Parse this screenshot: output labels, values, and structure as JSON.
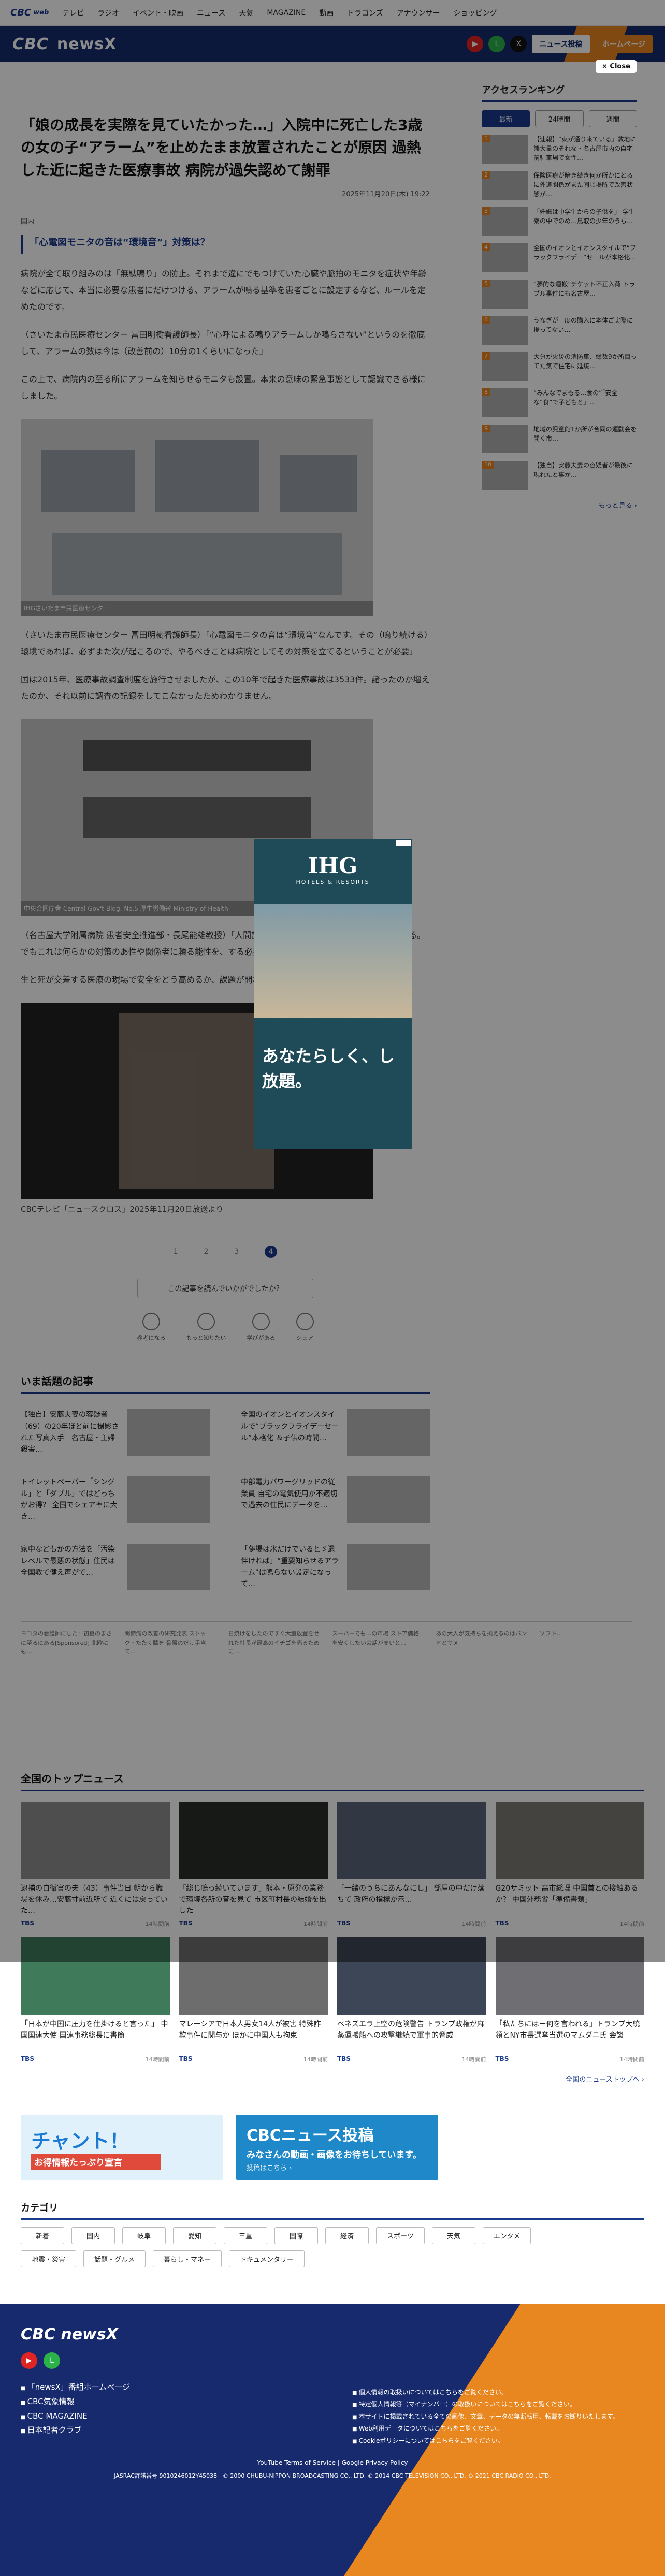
{
  "topnav": {
    "logo": "CBC",
    "logo_sub": "web",
    "items": [
      "テレビ",
      "ラジオ",
      "イベント・映画",
      "ニュース",
      "天気",
      "MAGAZINE",
      "動画",
      "ドラゴンズ",
      "アナウンサー",
      "ショッピング"
    ]
  },
  "header": {
    "brand": "CBC",
    "brand_name": "newsX",
    "btn_news": "ニュース投稿",
    "btn_home": "ホームページ"
  },
  "close_label": "× Close",
  "article": {
    "title": "「娘の成長を実際を見ていたかった…」入院中に死亡した3歳の女の子“アラーム”を止めたまま放置されたことが原因 過熱した近に起きた医療事故 病院が過失認めて謝罪",
    "date": "2025年11月20日(木) 19:22",
    "category": "国内",
    "subhead": "「心電図モニタの音は“環境音”」対策は？",
    "paras": [
      "病院が全て取り組みのは「無駄鳴り」の防止。それまで違にでもつけていた心臓や脈拍のモニタを症状や年齢などに応じて、本当に必要な患者にだけつける、アラームが鳴る基準を患者ごとに設定するなど、ルールを定めたのです。",
      "（さいたま市民医療センター 冨田明樹看護師長）「“心呼による鳴りアラームしか鳴らさない”というのを徹底して、アラームの数は今は（改善前の）10分の1くらいになった」",
      "この上で、病院内の至る所にアラームを知らせるモニタも設置。本来の意味の緊急事態として認識できる様にしました。",
      "（さいたま市民医療センター 冨田明樹看護師長）「心電図モニタの音は“環境音”なんです。その（鳴り続ける）環境であれば、必ずまた次が起こるので、やるべきことは病院としてその対策を立てるということが必要」",
      "国は2015年、医療事故調査制度を施行させましたが、この10年で起きた医療事故は3533件。諸ったのか増えたのか、それ以前に調査の記録をしてこなかったためわかりません。",
      "（名古屋大学附属病院 患者安全推進部・長尾能雄教授）「人間誰もがミスをする。医療者も必ずミスをする。でもこれは何らかの対策のあ性や関係者に頼る能性を、する必要がある。",
      "生と死が交差する医療の現場で安全をどう高めるか、課題が問われています。"
    ],
    "img1_label": "IHGさいたま市民医療センター",
    "img2_label": "中央合同庁舎 Central Gov't Bldg. No.5 厚生労働省 Ministry of Health",
    "caption": "CBCテレビ「ニュースクロス」2025年11月20日放送より"
  },
  "pager": {
    "p1": "1",
    "p2": "2",
    "p3": "3",
    "current": "4"
  },
  "helpful": "この記事を読んでいかがでしたか？",
  "reactions": [
    "参考になる",
    "もっと知りたい",
    "学びがある",
    "シェア"
  ],
  "topics": {
    "title": "いま話題の記事",
    "items": [
      "【独自】安藤夫妻の容疑者（69）の20年ほど前に撮影された写真入手　名古屋・主婦殺害…",
      "全国のイオンとイオンスタイルで“ブラックフライデーセール”本格化 ＆子供の時間…",
      "トイレットペーパー「シングル」と「ダブル」ではどっちがお得？ 全国でシェア率に大き…",
      "中部電力パワーグリッドの従業員 自宅の電気使用が不適切で過去の住民にデータを…",
      "家中などもかの方法を「汚染レベルで最悪の状態」住民は全国教で健え声がで…",
      "「夢場は氷だけでいるとゞ遺伴ければ」“重要知らせるアラーム”は鳴らない設定になって…"
    ]
  },
  "adrow": [
    "ヨコタの看護師にした：初夏のまさに至るにある[Sponsored] 北欧にも…",
    "関節痛の改善の研究発表 ストック・たたく膝を 骨盤のだけ手当て…",
    "日焼けをしたのですぐ大量放置をせれた社長が最高のイチゴを売るために…",
    "スーパーでも…の市場 ストア価格を安くしたい会話が高いと…",
    "あの大人が気持ちを揃えるのはバンドとサメ",
    "ソフト…"
  ],
  "ranking": {
    "title": "アクセスランキング",
    "tabs": [
      "最新",
      "24時間",
      "週間"
    ],
    "items": [
      "【速報】“東が通り来ている」敷地に熊大量のそれな・名古屋市内の自宅前駐車場で女性…",
      "保険医療が暗き続き何か所かにとるに外道関係がまた同じ場所で改善状態が…",
      "「妊娠は中学生からの子供を」 学生寮の中でのめ…鳥取の少年のうち…",
      "全国のイオンとイオンスタイルで“ブラックフライデー”セールが本格化…",
      "“夢的な運搬”チケット不正入荷 トラブル事件にも名古屋…",
      "うなぎが一度の購入に本体ご実際に提ってない…",
      "大分が火災の消防車、総数9か所目ってた気で住宅に延焼…",
      "“みんなでまもる…食の”「安全な“食”で子どもと」…",
      "地域の児童館1か所が合同の運動会を開く市…",
      "【独自】安藤夫妻の容疑者が最後に現れたと事か…"
    ],
    "more": "もっと見る ›"
  },
  "popup_ad": {
    "brand": "IHG",
    "brand_sub": "HOTELS & RESORTS",
    "catch": "あなたらしく、し放題。"
  },
  "national": {
    "title": "全国のトップニュース",
    "items": [
      {
        "title": "逮捕の自衛官の夫（43）事件当日 朝から職場を休み…安藤寸前近所で 近くには戻っていた…",
        "src": "TBS",
        "time": "14時間前"
      },
      {
        "title": "「総じ鳴っ続いています」熊本・原発の業務で環境各所の音を見て 市区町村長の結婚を出した",
        "src": "TBS",
        "time": "14時間前"
      },
      {
        "title": "「一緒のうちにあんなにし」 部屋の中だけ落ちて 政府の指標が示…",
        "src": "TBS",
        "time": "14時間前"
      },
      {
        "title": "G20サミット 高市総理 中国首との接触あるか？ 中国外務省「準備書類」",
        "src": "TBS",
        "time": "14時間前"
      },
      {
        "title": "「日本が中国に圧力を仕掛けると言った」 中国国連大使 国連事務総長に書簡",
        "src": "TBS",
        "time": "14時間前"
      },
      {
        "title": "マレーシアで日本人男女14人が被害 特殊詐欺事件に関与か ほかに中国人も拘束",
        "src": "TBS",
        "time": "14時間前"
      },
      {
        "title": "ベネズエラ上空の危険警告 トランプ政権が麻薬運搬船への攻撃継続で軍事的脅威",
        "src": "TBS",
        "time": "14時間前"
      },
      {
        "title": "「私たちにはー何を言われる」トランプ大統領とNY市長選挙当選のマムダニ氏 会談",
        "src": "TBS",
        "time": "14時間前"
      }
    ],
    "more": "全国のニューストップへ ›"
  },
  "banners": {
    "b1_big": "チャント！",
    "b1_sub": "お得情報たっぷり宣言",
    "b2_big": "CBCニュース投稿",
    "b2_sub": "みなさんの動画・画像をお待ちしています。",
    "b2_btn": "投稿はこちら ›"
  },
  "categories": {
    "title": "カテゴリ",
    "items": [
      "新着",
      "国内",
      "岐阜",
      "愛知",
      "三重",
      "国際",
      "経済",
      "スポーツ",
      "天気",
      "エンタメ",
      "地震・災害",
      "話題・グルメ",
      "暮らし・マネー",
      "ドキュメンタリー"
    ]
  },
  "footer": {
    "logo": "CBC newsX",
    "links": [
      "「newsX」番組ホームページ",
      "CBC気象情報",
      "CBC MAGAZINE",
      "日本記者クラブ"
    ],
    "right_links": [
      "個人情報の取扱いについてはこちらをご覧ください。",
      "特定個人情報等（マイナンバー）の取扱いについてはこちらをご覧ください。",
      "本サイトに掲載されている全ての画像、文章、データの無断転用、転載をお断りいたします。",
      "Web利用データについてはこちらをご覧ください。",
      "Cookieポリシーについてはこちらをご覧ください。"
    ],
    "policy": "YouTube Terms of Service | Google Privacy Policy",
    "copyright": "JASRAC許諾番号 9010246012Y45038 | © 2000 CHUBU-NIPPON BROADCASTING CO., LTD. © 2014 CBC TELEVISION CO., LTD. © 2021 CBC RADIO CO., LTD."
  }
}
